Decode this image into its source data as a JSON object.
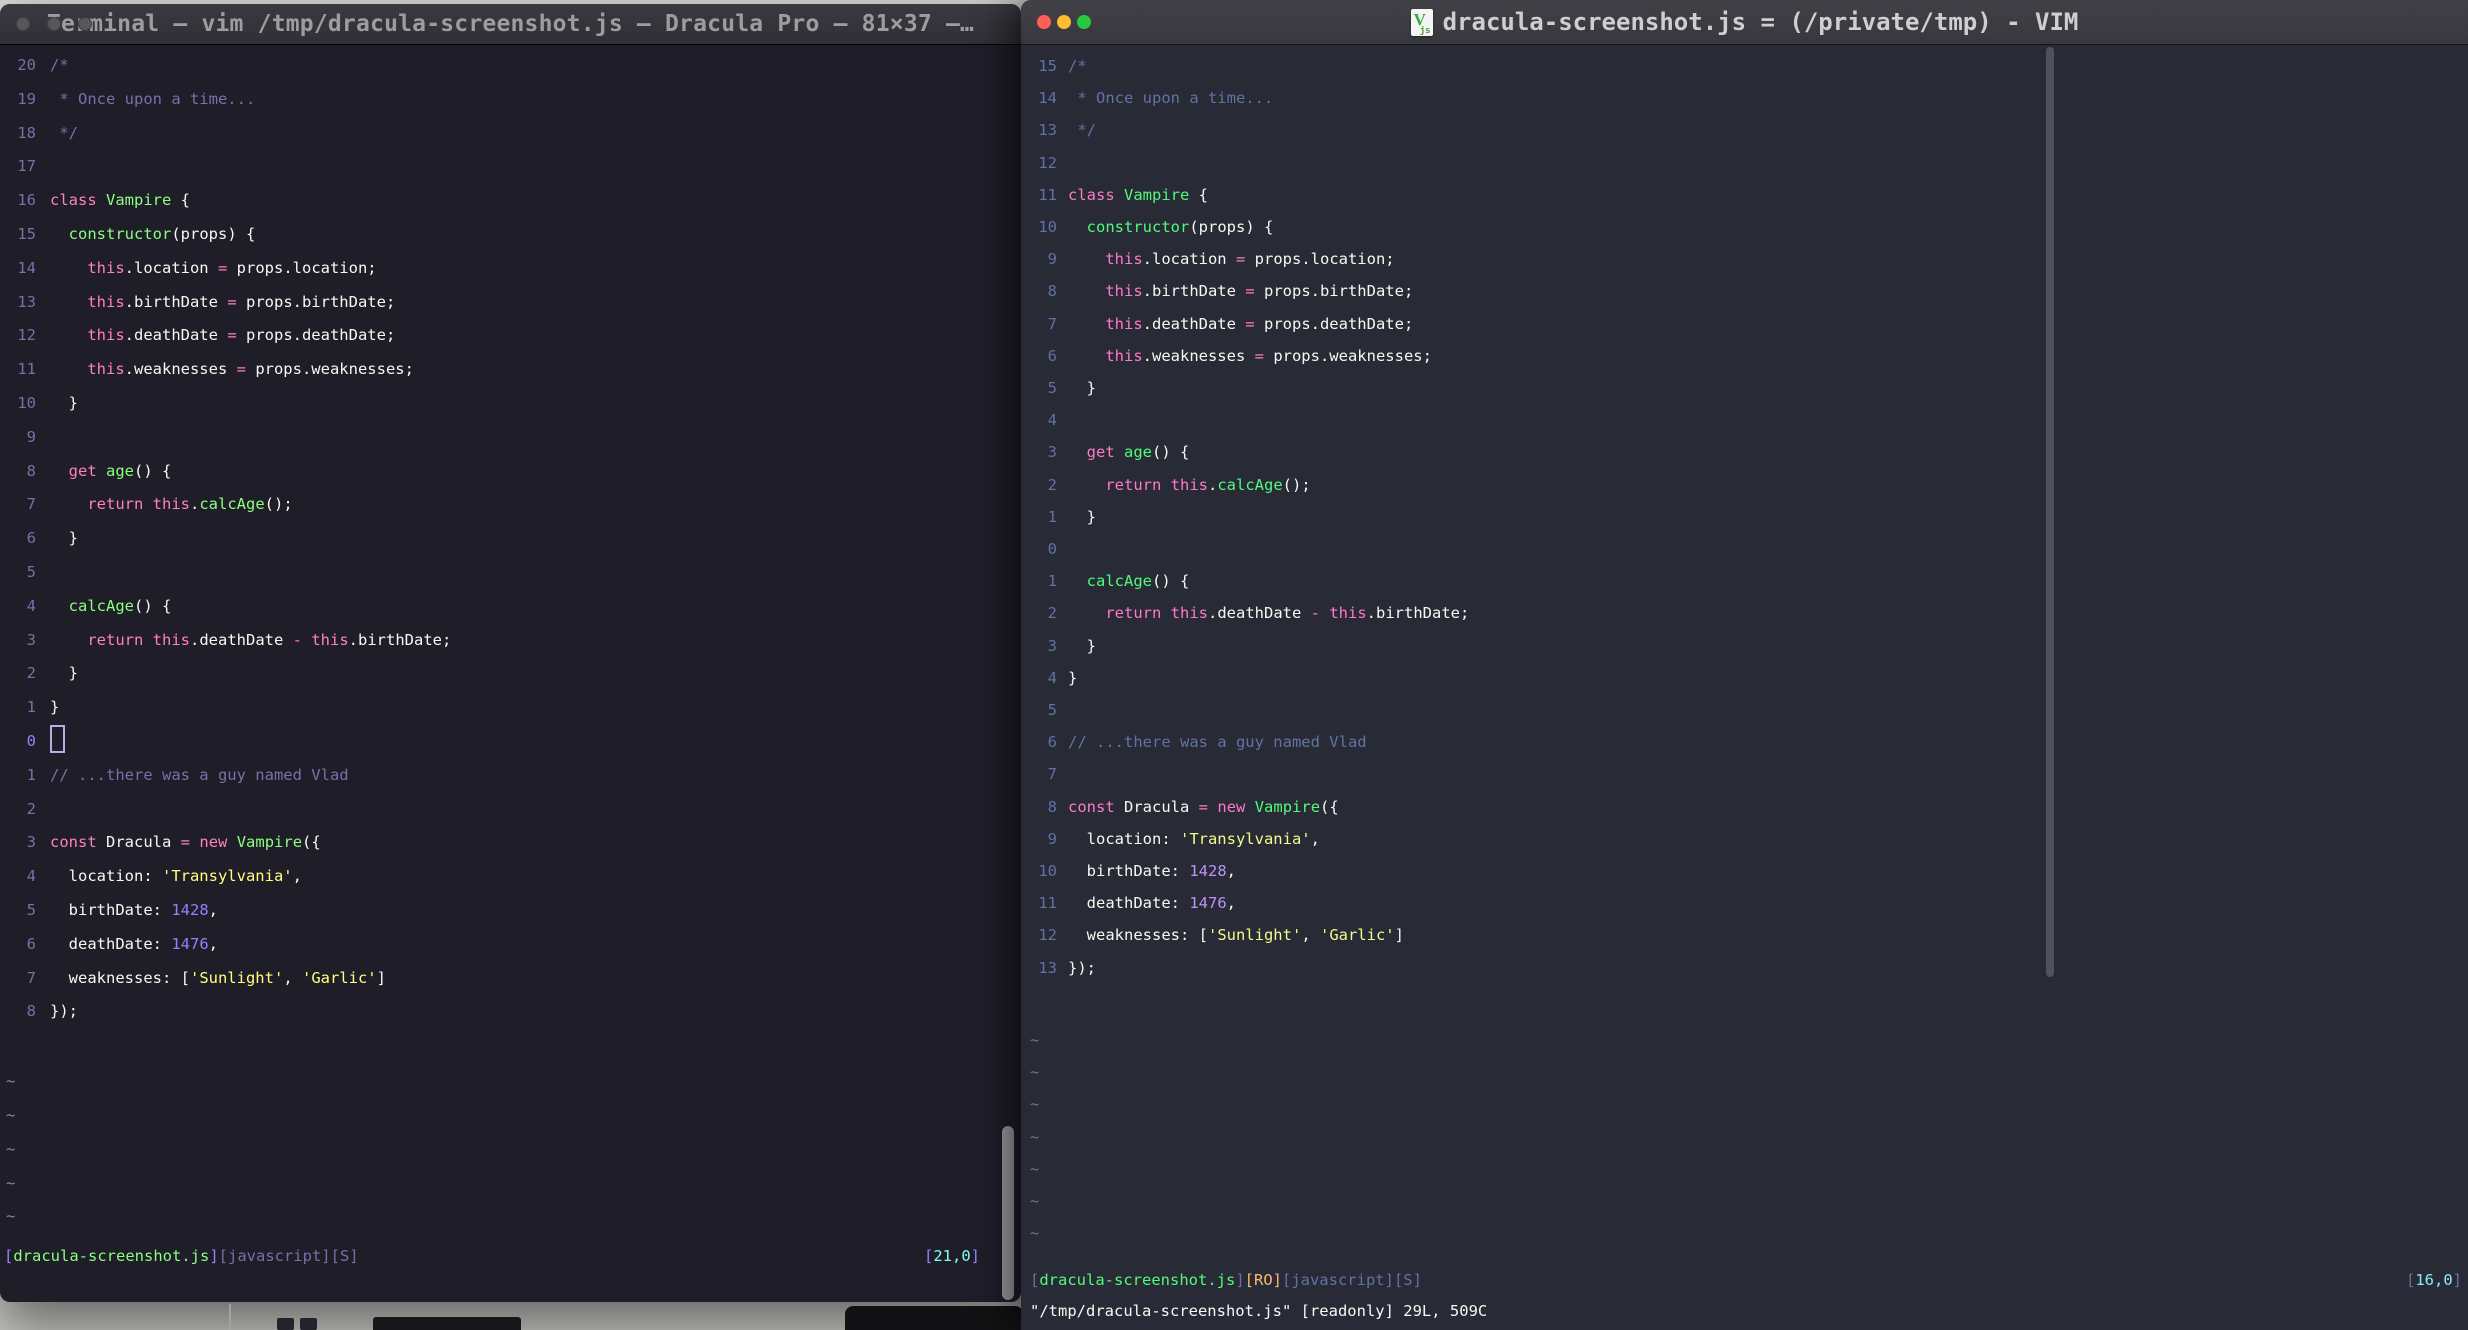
{
  "left_window": {
    "kind": "terminal-vim",
    "title": "Terminal — vim /tmp/dracula-screenshot.js — Dracula Pro — 81×37 —…",
    "theme": {
      "name": "Dracula Pro",
      "background": "#1e1d28",
      "foreground": "#F8F8F2",
      "comment": "#7970A9",
      "pink": "#FF80BF",
      "green": "#8AFF80",
      "purple": "#9580FF",
      "yellow": "#FFFF80",
      "cyan": "#80FFEA",
      "line_number": "#7970A9"
    },
    "tilde_count": 5,
    "lines": [
      {
        "n": "20",
        "seg": [
          [
            "/*",
            "c"
          ]
        ]
      },
      {
        "n": "19",
        "seg": [
          [
            " * Once upon a time...",
            "c"
          ]
        ]
      },
      {
        "n": "18",
        "seg": [
          [
            " */",
            "c"
          ]
        ]
      },
      {
        "n": "17",
        "seg": []
      },
      {
        "n": "16",
        "seg": [
          [
            "class",
            "p"
          ],
          [
            " ",
            "f"
          ],
          [
            "Vampire",
            "g"
          ],
          [
            " {",
            "f"
          ]
        ]
      },
      {
        "n": "15",
        "seg": [
          [
            "  ",
            "f"
          ],
          [
            "constructor",
            "g"
          ],
          [
            "(props) {",
            "f"
          ]
        ]
      },
      {
        "n": "14",
        "seg": [
          [
            "    ",
            "f"
          ],
          [
            "this",
            "p"
          ],
          [
            ".location ",
            "f"
          ],
          [
            "=",
            "p"
          ],
          [
            " props.location;",
            "f"
          ]
        ]
      },
      {
        "n": "13",
        "seg": [
          [
            "    ",
            "f"
          ],
          [
            "this",
            "p"
          ],
          [
            ".birthDate ",
            "f"
          ],
          [
            "=",
            "p"
          ],
          [
            " props.birthDate;",
            "f"
          ]
        ]
      },
      {
        "n": "12",
        "seg": [
          [
            "    ",
            "f"
          ],
          [
            "this",
            "p"
          ],
          [
            ".deathDate ",
            "f"
          ],
          [
            "=",
            "p"
          ],
          [
            " props.deathDate;",
            "f"
          ]
        ]
      },
      {
        "n": "11",
        "seg": [
          [
            "    ",
            "f"
          ],
          [
            "this",
            "p"
          ],
          [
            ".weaknesses ",
            "f"
          ],
          [
            "=",
            "p"
          ],
          [
            " props.weaknesses;",
            "f"
          ]
        ]
      },
      {
        "n": "10",
        "seg": [
          [
            "  }",
            "f"
          ]
        ]
      },
      {
        "n": "9",
        "seg": []
      },
      {
        "n": "8",
        "seg": [
          [
            "  ",
            "f"
          ],
          [
            "get",
            "p"
          ],
          [
            " ",
            "f"
          ],
          [
            "age",
            "g"
          ],
          [
            "() {",
            "f"
          ]
        ]
      },
      {
        "n": "7",
        "seg": [
          [
            "    ",
            "f"
          ],
          [
            "return",
            "p"
          ],
          [
            " ",
            "f"
          ],
          [
            "this",
            "p"
          ],
          [
            ".",
            "f"
          ],
          [
            "calcAge",
            "g"
          ],
          [
            "();",
            "f"
          ]
        ]
      },
      {
        "n": "6",
        "seg": [
          [
            "  }",
            "f"
          ]
        ]
      },
      {
        "n": "5",
        "seg": []
      },
      {
        "n": "4",
        "seg": [
          [
            "  ",
            "f"
          ],
          [
            "calcAge",
            "g"
          ],
          [
            "() {",
            "f"
          ]
        ]
      },
      {
        "n": "3",
        "seg": [
          [
            "    ",
            "f"
          ],
          [
            "return",
            "p"
          ],
          [
            " ",
            "f"
          ],
          [
            "this",
            "p"
          ],
          [
            ".deathDate ",
            "f"
          ],
          [
            "-",
            "p"
          ],
          [
            " ",
            "f"
          ],
          [
            "this",
            "p"
          ],
          [
            ".birthDate;",
            "f"
          ]
        ]
      },
      {
        "n": "2",
        "seg": [
          [
            "  }",
            "f"
          ]
        ]
      },
      {
        "n": "1",
        "seg": [
          [
            "}",
            "f"
          ]
        ]
      },
      {
        "n": "0",
        "cursor": true,
        "seg": []
      },
      {
        "n": "1",
        "seg": [
          [
            "// ...there was a guy named Vlad",
            "c"
          ]
        ]
      },
      {
        "n": "2",
        "seg": []
      },
      {
        "n": "3",
        "seg": [
          [
            "const",
            "p"
          ],
          [
            " Dracula ",
            "f"
          ],
          [
            "=",
            "p"
          ],
          [
            " ",
            "f"
          ],
          [
            "new",
            "p"
          ],
          [
            " ",
            "f"
          ],
          [
            "Vampire",
            "g"
          ],
          [
            "({",
            "f"
          ]
        ]
      },
      {
        "n": "4",
        "seg": [
          [
            "  location: ",
            "f"
          ],
          [
            "'Transylvania'",
            "s"
          ],
          [
            ",",
            "f"
          ]
        ]
      },
      {
        "n": "5",
        "seg": [
          [
            "  birthDate: ",
            "f"
          ],
          [
            "1428",
            "n"
          ],
          [
            ",",
            "f"
          ]
        ]
      },
      {
        "n": "6",
        "seg": [
          [
            "  deathDate: ",
            "f"
          ],
          [
            "1476",
            "n"
          ],
          [
            ",",
            "f"
          ]
        ]
      },
      {
        "n": "7",
        "seg": [
          [
            "  weaknesses: [",
            "f"
          ],
          [
            "'Sunlight'",
            "s"
          ],
          [
            ", ",
            "f"
          ],
          [
            "'Garlic'",
            "s"
          ],
          [
            "]",
            "f"
          ]
        ]
      },
      {
        "n": "8",
        "seg": [
          [
            "});",
            "f"
          ]
        ]
      }
    ],
    "status_left": [
      [
        "[",
        "lav"
      ],
      [
        "dracula-screenshot.js",
        "g"
      ],
      [
        "]",
        "lav"
      ],
      [
        "[javascript][S]",
        "c"
      ]
    ],
    "status_right": [
      [
        "[",
        "lav"
      ],
      [
        "21,0",
        "cy"
      ],
      [
        "]",
        "lav"
      ]
    ]
  },
  "right_window": {
    "kind": "macvim",
    "title": "dracula-screenshot.js = (/private/tmp) - VIM",
    "theme": {
      "name": "Dracula",
      "background": "#282a36",
      "foreground": "#F8F8F2",
      "comment": "#6272A4",
      "pink": "#FF79C6",
      "green": "#50FA7B",
      "purple": "#BD93F9",
      "yellow": "#F1FA8C",
      "cyan": "#8BE9FD",
      "orange": "#FFB86C",
      "line_number": "#6272A4"
    },
    "tilde_count": 7,
    "lines": [
      {
        "n": "15",
        "seg": [
          [
            "/*",
            "c"
          ]
        ]
      },
      {
        "n": "14",
        "seg": [
          [
            " * Once upon a time...",
            "c"
          ]
        ]
      },
      {
        "n": "13",
        "seg": [
          [
            " */",
            "c"
          ]
        ]
      },
      {
        "n": "12",
        "seg": []
      },
      {
        "n": "11",
        "seg": [
          [
            "class",
            "p"
          ],
          [
            " ",
            "f"
          ],
          [
            "Vampire",
            "g"
          ],
          [
            " {",
            "f"
          ]
        ]
      },
      {
        "n": "10",
        "seg": [
          [
            "  ",
            "f"
          ],
          [
            "constructor",
            "g"
          ],
          [
            "(props) {",
            "f"
          ]
        ]
      },
      {
        "n": "9",
        "seg": [
          [
            "    ",
            "f"
          ],
          [
            "this",
            "p"
          ],
          [
            ".location ",
            "f"
          ],
          [
            "=",
            "p"
          ],
          [
            " props.location;",
            "f"
          ]
        ]
      },
      {
        "n": "8",
        "seg": [
          [
            "    ",
            "f"
          ],
          [
            "this",
            "p"
          ],
          [
            ".birthDate ",
            "f"
          ],
          [
            "=",
            "p"
          ],
          [
            " props.birthDate;",
            "f"
          ]
        ]
      },
      {
        "n": "7",
        "seg": [
          [
            "    ",
            "f"
          ],
          [
            "this",
            "p"
          ],
          [
            ".deathDate ",
            "f"
          ],
          [
            "=",
            "p"
          ],
          [
            " props.deathDate;",
            "f"
          ]
        ]
      },
      {
        "n": "6",
        "seg": [
          [
            "    ",
            "f"
          ],
          [
            "this",
            "p"
          ],
          [
            ".weaknesses ",
            "f"
          ],
          [
            "=",
            "p"
          ],
          [
            " props.weaknesses;",
            "f"
          ]
        ]
      },
      {
        "n": "5",
        "seg": [
          [
            "  }",
            "f"
          ]
        ]
      },
      {
        "n": "4",
        "seg": []
      },
      {
        "n": "3",
        "seg": [
          [
            "  ",
            "f"
          ],
          [
            "get",
            "p"
          ],
          [
            " ",
            "f"
          ],
          [
            "age",
            "g"
          ],
          [
            "() {",
            "f"
          ]
        ]
      },
      {
        "n": "2",
        "seg": [
          [
            "    ",
            "f"
          ],
          [
            "return",
            "p"
          ],
          [
            " ",
            "f"
          ],
          [
            "this",
            "p"
          ],
          [
            ".",
            "f"
          ],
          [
            "calcAge",
            "g"
          ],
          [
            "();",
            "f"
          ]
        ]
      },
      {
        "n": "1",
        "seg": [
          [
            "  }",
            "f"
          ]
        ]
      },
      {
        "n": "0",
        "cursor": false,
        "cur": true,
        "seg": []
      },
      {
        "n": "1",
        "seg": [
          [
            "  ",
            "f"
          ],
          [
            "calcAge",
            "g"
          ],
          [
            "() {",
            "f"
          ]
        ]
      },
      {
        "n": "2",
        "seg": [
          [
            "    ",
            "f"
          ],
          [
            "return",
            "p"
          ],
          [
            " ",
            "f"
          ],
          [
            "this",
            "p"
          ],
          [
            ".deathDate ",
            "f"
          ],
          [
            "-",
            "p"
          ],
          [
            " ",
            "f"
          ],
          [
            "this",
            "p"
          ],
          [
            ".birthDate;",
            "f"
          ]
        ]
      },
      {
        "n": "3",
        "seg": [
          [
            "  }",
            "f"
          ]
        ]
      },
      {
        "n": "4",
        "seg": [
          [
            "}",
            "f"
          ]
        ]
      },
      {
        "n": "5",
        "seg": []
      },
      {
        "n": "6",
        "seg": [
          [
            "// ...there was a guy named Vlad",
            "c"
          ]
        ]
      },
      {
        "n": "7",
        "seg": []
      },
      {
        "n": "8",
        "seg": [
          [
            "const",
            "p"
          ],
          [
            " Dracula ",
            "f"
          ],
          [
            "=",
            "p"
          ],
          [
            " ",
            "f"
          ],
          [
            "new",
            "p"
          ],
          [
            " ",
            "f"
          ],
          [
            "Vampire",
            "g"
          ],
          [
            "({",
            "f"
          ]
        ]
      },
      {
        "n": "9",
        "seg": [
          [
            "  location: ",
            "f"
          ],
          [
            "'Transylvania'",
            "s"
          ],
          [
            ",",
            "f"
          ]
        ]
      },
      {
        "n": "10",
        "seg": [
          [
            "  birthDate: ",
            "f"
          ],
          [
            "1428",
            "n"
          ],
          [
            ",",
            "f"
          ]
        ]
      },
      {
        "n": "11",
        "seg": [
          [
            "  deathDate: ",
            "f"
          ],
          [
            "1476",
            "n"
          ],
          [
            ",",
            "f"
          ]
        ]
      },
      {
        "n": "12",
        "seg": [
          [
            "  weaknesses: [",
            "f"
          ],
          [
            "'Sunlight'",
            "s"
          ],
          [
            ", ",
            "f"
          ],
          [
            "'Garlic'",
            "s"
          ],
          [
            "]",
            "f"
          ]
        ]
      },
      {
        "n": "13",
        "seg": [
          [
            "});",
            "f"
          ]
        ]
      }
    ],
    "status_left": [
      [
        "[",
        "lav"
      ],
      [
        "dracula-screenshot.js",
        "g"
      ],
      [
        "]",
        "lav"
      ],
      [
        "[RO]",
        "o"
      ],
      [
        "[javascript][S]",
        "c"
      ]
    ],
    "status_right": [
      [
        "[",
        "lav"
      ],
      [
        "16,0",
        "cy"
      ],
      [
        "]",
        "lav"
      ]
    ],
    "cmdline": "\"/tmp/dracula-screenshot.js\" [readonly] 29L, 509C"
  }
}
